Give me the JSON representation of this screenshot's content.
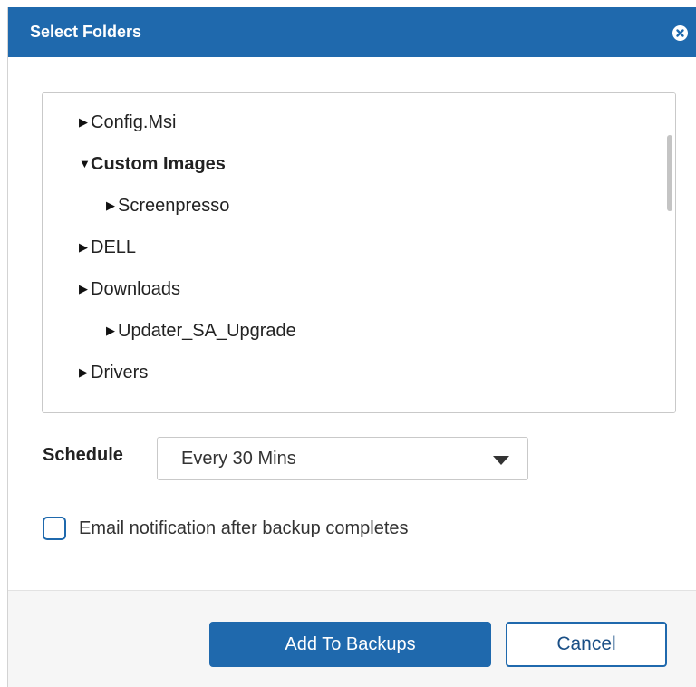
{
  "dialog": {
    "title": "Select Folders",
    "close_icon": "close-circle-icon"
  },
  "tree": {
    "items": [
      {
        "label": "Config.Msi",
        "expanded": false,
        "level": 0
      },
      {
        "label": "Custom Images",
        "expanded": true,
        "level": 0
      },
      {
        "label": "Screenpresso",
        "expanded": false,
        "level": 1
      },
      {
        "label": "DELL",
        "expanded": false,
        "level": 0
      },
      {
        "label": "Downloads",
        "expanded": false,
        "level": 0
      },
      {
        "label": "Updater_SA_Upgrade",
        "expanded": false,
        "level": 1
      },
      {
        "label": "Drivers",
        "expanded": false,
        "level": 0
      }
    ]
  },
  "schedule": {
    "label": "Schedule",
    "value": "Every 30 Mins"
  },
  "email_notification": {
    "label": "Email notification after backup completes",
    "checked": false
  },
  "buttons": {
    "add_label": "Add To Backups",
    "cancel_label": "Cancel"
  },
  "colors": {
    "accent": "#1f69ad",
    "footer_bg": "#f6f6f6"
  }
}
